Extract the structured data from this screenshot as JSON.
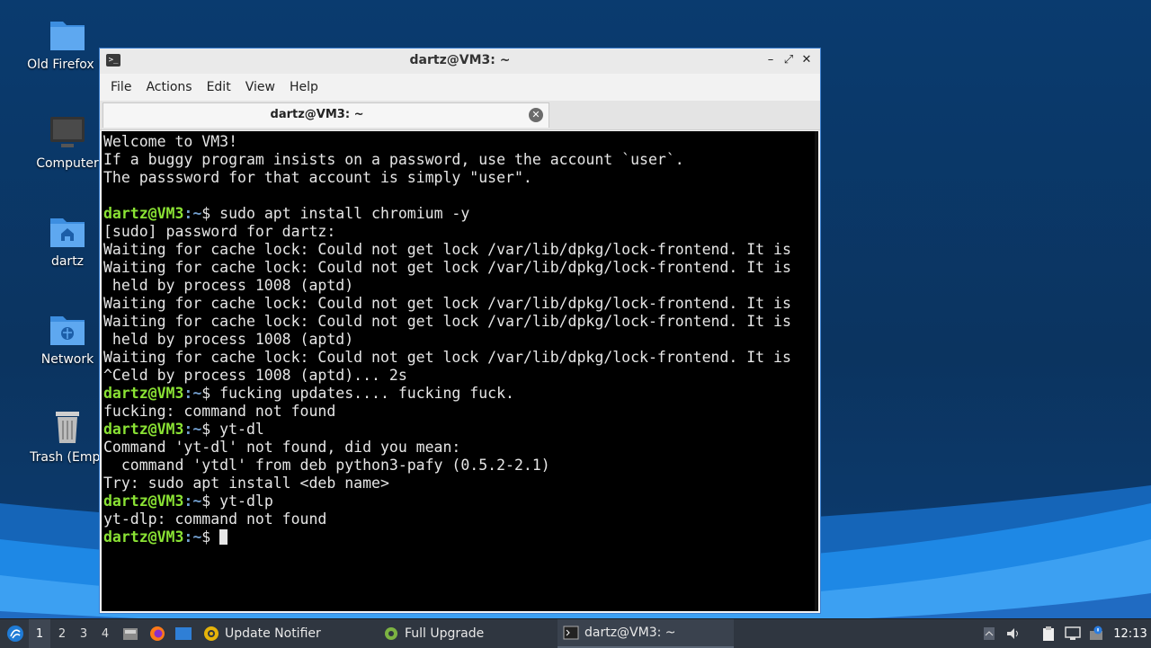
{
  "desktop": {
    "icons": [
      {
        "label": "Old Firefox D",
        "icon": "folder-icon"
      },
      {
        "label": "Computer",
        "icon": "computer-icon"
      },
      {
        "label": "dartz",
        "icon": "home-folder-icon"
      },
      {
        "label": "Network",
        "icon": "network-folder-icon"
      },
      {
        "label": "Trash (Empt",
        "icon": "trash-icon"
      }
    ]
  },
  "window": {
    "title": "dartz@VM3: ~",
    "menu": [
      "File",
      "Actions",
      "Edit",
      "View",
      "Help"
    ],
    "tab_label": "dartz@VM3: ~",
    "controls": {
      "minimize": "–",
      "maximize": "⤢",
      "close": "✕"
    }
  },
  "terminal": {
    "prompt_user": "dartz@VM3",
    "prompt_path": ":~",
    "prompt_sym": "$ ",
    "lines": [
      {
        "text": "Welcome to VM3!"
      },
      {
        "text": "If a buggy program insists on a password, use the account `user`."
      },
      {
        "text": "The passsword for that account is simply \"user\"."
      },
      {
        "text": ""
      },
      {
        "prompt": true,
        "cmd": "sudo apt install chromium -y"
      },
      {
        "text": "[sudo] password for dartz:"
      },
      {
        "text": "Waiting for cache lock: Could not get lock /var/lib/dpkg/lock-frontend. It is"
      },
      {
        "text": "Waiting for cache lock: Could not get lock /var/lib/dpkg/lock-frontend. It is"
      },
      {
        "text": " held by process 1008 (aptd)"
      },
      {
        "text": "Waiting for cache lock: Could not get lock /var/lib/dpkg/lock-frontend. It is"
      },
      {
        "text": "Waiting for cache lock: Could not get lock /var/lib/dpkg/lock-frontend. It is"
      },
      {
        "text": " held by process 1008 (aptd)"
      },
      {
        "text": "Waiting for cache lock: Could not get lock /var/lib/dpkg/lock-frontend. It is"
      },
      {
        "text": "^Celd by process 1008 (aptd)... 2s"
      },
      {
        "prompt": true,
        "cmd": "fucking updates.... fucking fuck."
      },
      {
        "text": "fucking: command not found"
      },
      {
        "prompt": true,
        "cmd": "yt-dl"
      },
      {
        "text": "Command 'yt-dl' not found, did you mean:"
      },
      {
        "text": "  command 'ytdl' from deb python3-pafy (0.5.2-2.1)"
      },
      {
        "text": "Try: sudo apt install <deb name>"
      },
      {
        "prompt": true,
        "cmd": "yt-dlp"
      },
      {
        "text": "yt-dlp: command not found"
      },
      {
        "prompt": true,
        "cmd": "",
        "cursor": true
      }
    ]
  },
  "taskbar": {
    "workspaces": [
      "1",
      "2",
      "3",
      "4"
    ],
    "active_workspace": "1",
    "windows": [
      {
        "label": "Update Notifier",
        "icon": "update-notifier-icon"
      },
      {
        "label": "Full Upgrade",
        "icon": "gear-icon"
      },
      {
        "label": "dartz@VM3: ~",
        "icon": "terminal-icon",
        "active": true
      }
    ],
    "clock": "12:13"
  }
}
